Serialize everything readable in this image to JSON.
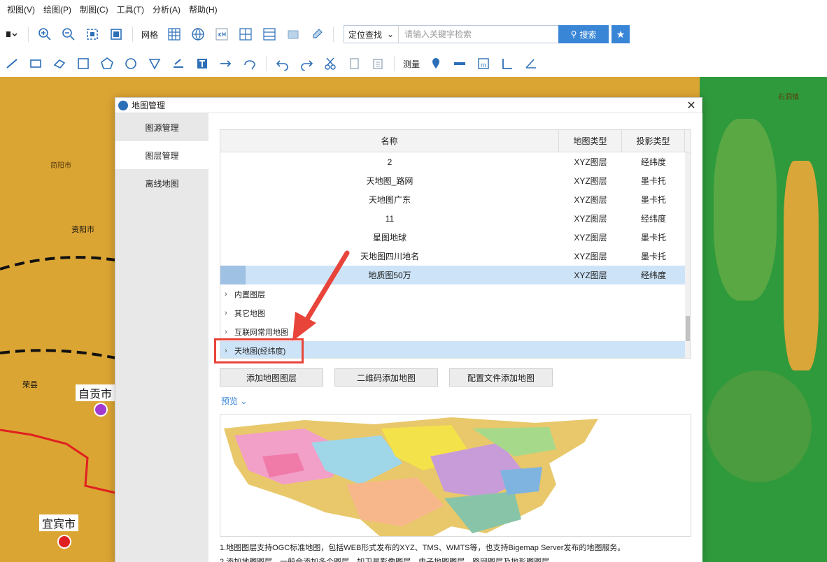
{
  "menu": [
    "视图(V)",
    "绘图(P)",
    "制图(C)",
    "工具(T)",
    "分析(A)",
    "帮助(H)"
  ],
  "toolbar": {
    "grid_label": "网格",
    "measure_label": "测量",
    "search": {
      "type": "定位查找",
      "placeholder": "请输入关键字检索",
      "button": "搜索"
    }
  },
  "map": {
    "labels": [
      {
        "text": "资阳市"
      },
      {
        "text": "荣县"
      },
      {
        "text": "宜宾市"
      },
      {
        "text": "石洞镇"
      },
      {
        "text": "简阳市"
      },
      {
        "text": "自贡市"
      }
    ],
    "cities": [
      {
        "name": "自贡市"
      },
      {
        "name": "宜宾市"
      }
    ]
  },
  "dialog": {
    "title": "地图管理",
    "sidebar": [
      "图源管理",
      "图层管理",
      "离线地图"
    ],
    "sidebar_active": 1,
    "table": {
      "headers": [
        "名称",
        "地图类型",
        "投影类型"
      ],
      "rows": [
        {
          "name": "2",
          "type": "XYZ图层",
          "proj": "经纬度"
        },
        {
          "name": "天地图_路网",
          "type": "XYZ图层",
          "proj": "墨卡托"
        },
        {
          "name": "天地图广东",
          "type": "XYZ图层",
          "proj": "墨卡托"
        },
        {
          "name": "11",
          "type": "XYZ图层",
          "proj": "经纬度"
        },
        {
          "name": "星图地球",
          "type": "XYZ图层",
          "proj": "墨卡托"
        },
        {
          "name": "天地图四川地名",
          "type": "XYZ图层",
          "proj": "墨卡托"
        },
        {
          "name": "地质图50万",
          "type": "XYZ图层",
          "proj": "经纬度"
        }
      ],
      "selected_row": 6,
      "tree": [
        "内置图层",
        "其它地图",
        "互联网常用地图",
        "天地图(经纬度)"
      ]
    },
    "buttons": [
      "添加地图图层",
      "二维码添加地图",
      "配置文件添加地图"
    ],
    "preview_label": "预览",
    "notes": [
      "1.地图图层支持OGC标准地图，包括WEB形式发布的XYZ、TMS、WMTS等，也支持Bigemap Server发布的地图服务。",
      "2.添加地图图层，一般会添加多个图层，如卫星影像图层、电子地图图层、路网图层及地形图图层。"
    ]
  },
  "colors": {
    "accent": "#3a86d6",
    "highlight": "#e8443a",
    "selection": "#cde3f7"
  }
}
